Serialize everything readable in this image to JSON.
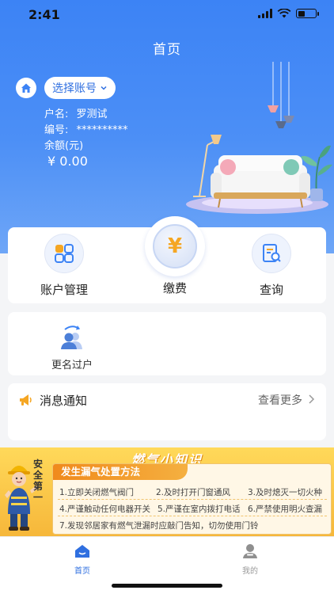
{
  "status_bar": {
    "time": "2:41"
  },
  "header": {
    "title": "首页"
  },
  "account": {
    "select_label": "选择账号",
    "name_label": "户名:",
    "name_value": "罗测试",
    "number_label": "编号:",
    "number_value": "**********",
    "balance_label": "余额(元)",
    "balance_value": "¥ 0.00"
  },
  "functions": {
    "account_mgmt": "账户管理",
    "pay": "缴费",
    "pay_symbol": "¥",
    "query": "查询"
  },
  "transfer": {
    "label": "更名过户"
  },
  "notice": {
    "title": "消息通知",
    "more": "查看更多"
  },
  "banner": {
    "heading": "燃气小知识",
    "safety_text": "安全第一",
    "subtitle": "发生漏气处置方法",
    "tips": [
      "1.立即关闭燃气阀门",
      "2.及时打开门窗通风",
      "3.及时熄灭一切火种",
      "4.严谨触动任何电器开关",
      "5.严谨在室内拨打电话",
      "6.严禁使用明火查漏",
      "7.发现邻居家有燃气泄漏时应敲门告知，切勿使用门铃"
    ]
  },
  "tabs": {
    "home": "首页",
    "mine": "我的"
  },
  "colors": {
    "primary": "#3c83f5",
    "accent_orange": "#f5a623"
  }
}
